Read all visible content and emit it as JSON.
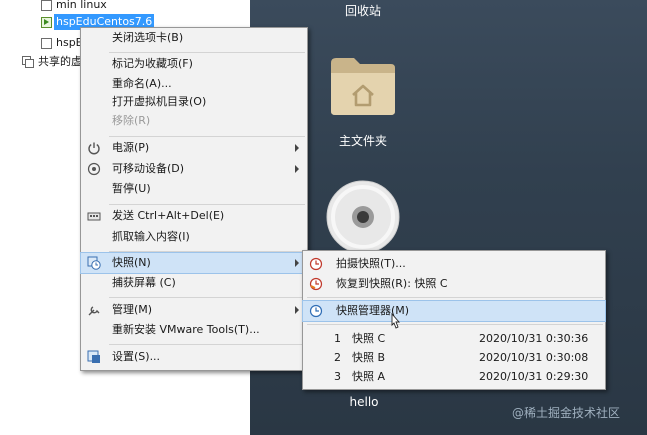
{
  "library": {
    "items": [
      {
        "label": "min linux",
        "state": "stopped"
      },
      {
        "label": "hspEduCentos7.6",
        "state": "running",
        "selected": true
      },
      {
        "label": "hspE",
        "state": "stopped"
      }
    ],
    "shared_label": "共享的虚"
  },
  "desktop": {
    "recycle_bin_label": "回收站",
    "home_folder_label": "主文件夹",
    "disc_label": "hello",
    "watermark": "@稀土掘金技术社区"
  },
  "context_menu": {
    "items": [
      {
        "label": "关闭选项卡(B)",
        "icon": "none"
      },
      {
        "label": "标记为收藏项(F)",
        "icon": "none"
      },
      {
        "label": "重命名(A)...",
        "icon": "none"
      },
      {
        "label": "打开虚拟机目录(O)",
        "icon": "none"
      },
      {
        "label": "移除(R)",
        "icon": "none",
        "disabled": true
      },
      {
        "label": "电源(P)",
        "icon": "power-icon",
        "submenu": true
      },
      {
        "label": "可移动设备(D)",
        "icon": "removable-device-icon",
        "submenu": true
      },
      {
        "label": "暂停(U)",
        "icon": "none"
      },
      {
        "label": "发送 Ctrl+Alt+Del(E)",
        "icon": "keyboard-icon"
      },
      {
        "label": "抓取输入内容(I)",
        "icon": "none"
      },
      {
        "label": "快照(N)",
        "icon": "snapshot-icon",
        "submenu": true,
        "highlighted": true
      },
      {
        "label": "捕获屏幕 (C)",
        "icon": "none"
      },
      {
        "label": "管理(M)",
        "icon": "manage-icon",
        "submenu": true
      },
      {
        "label": "重新安装 VMware Tools(T)...",
        "icon": "none"
      },
      {
        "label": "设置(S)...",
        "icon": "settings-icon"
      }
    ]
  },
  "snapshot_menu": {
    "take_snapshot": "拍摄快照(T)...",
    "revert": "恢复到快照(R): 快照 C",
    "manager": "快照管理器(M)",
    "snapshots": [
      {
        "index": "1",
        "name": "快照 C",
        "time": "2020/10/31 0:30:36"
      },
      {
        "index": "2",
        "name": "快照 B",
        "time": "2020/10/31 0:30:08"
      },
      {
        "index": "3",
        "name": "快照 A",
        "time": "2020/10/31 0:29:30"
      }
    ]
  },
  "colors": {
    "selection": "#3399ff",
    "menu_background": "#f2f2f2",
    "menu_highlight": "#cfe3f7",
    "desktop": "#34424f"
  }
}
